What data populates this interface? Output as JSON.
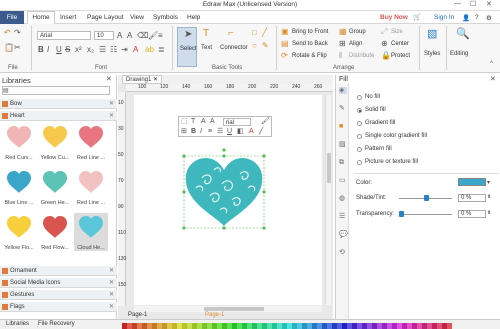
{
  "window": {
    "title": "Edraw Max (Unlicensed Version)"
  },
  "menu": {
    "file": "File",
    "tabs": [
      "Home",
      "Insert",
      "Page Layout",
      "View",
      "Symbols",
      "Help"
    ],
    "buy_now": "Buy Now",
    "sign_in": "Sign In"
  },
  "ribbon": {
    "font_name": "Arial",
    "font_size": "10",
    "groups": {
      "file": "File",
      "font": "Font",
      "basic_tools": "Basic Tools",
      "arrange": "Arrange",
      "styles": "Styles",
      "editing": "Editing"
    },
    "tools": {
      "select": "Select",
      "text": "Text",
      "connector": "Connector"
    },
    "arrange": {
      "bring_front": "Bring to Front",
      "send_back": "Send to Back",
      "rotate_flip": "Rotate & Flip",
      "group": "Group",
      "align": "Align",
      "distribute": "Distribute",
      "size": "Size",
      "center": "Center",
      "protect": "Protect"
    }
  },
  "libraries": {
    "title": "Libraries",
    "categories": [
      "Bow",
      "Heart",
      "Ornament",
      "Social Media Icons",
      "Gestures",
      "Flags"
    ],
    "shapes": [
      {
        "label": "Red Curv...",
        "color": "#f2b5b5"
      },
      {
        "label": "Yellow Cu...",
        "color": "#f6c84c"
      },
      {
        "label": "Red Line ...",
        "color": "#e8757f"
      },
      {
        "label": "Blue Line ...",
        "color": "#3aa6c9"
      },
      {
        "label": "Green He...",
        "color": "#5bc4b4"
      },
      {
        "label": "Red Line ...",
        "color": "#f2c2c2"
      },
      {
        "label": "Yellow Flo...",
        "color": "#f6cf3a"
      },
      {
        "label": "Red Flow...",
        "color": "#d9534f"
      },
      {
        "label": "Cloud He...",
        "color": "#5bc6d9"
      }
    ]
  },
  "canvas": {
    "tab": "Drawing1",
    "font_mini": "rial",
    "ruler_h": [
      "100",
      "120",
      "140",
      "160",
      "180",
      "200",
      "220",
      "240",
      "260"
    ],
    "ruler_v": [
      "10",
      "30",
      "50",
      "70",
      "90",
      "110",
      "130",
      "150"
    ],
    "page_tab": "Page-1",
    "page_tab_active": "Page-1"
  },
  "fill_panel": {
    "title": "Fill",
    "options": [
      "No fill",
      "Solid fill",
      "Gradient fill",
      "Single color gradient fill",
      "Pattern fill",
      "Picture or texture fill"
    ],
    "selected_index": 1,
    "color_label": "Color:",
    "shade_label": "Shade/Tint:",
    "shade_value": "0 %",
    "transparency_label": "Transparency:",
    "transparency_value": "0 %",
    "selected_color": "#3aa6c9"
  },
  "status": {
    "libraries_tab": "Libraries",
    "file_recovery_tab": "File Recovery"
  },
  "colors": {
    "accent": "#3c5a8c",
    "heart": "#3fb8bd"
  }
}
